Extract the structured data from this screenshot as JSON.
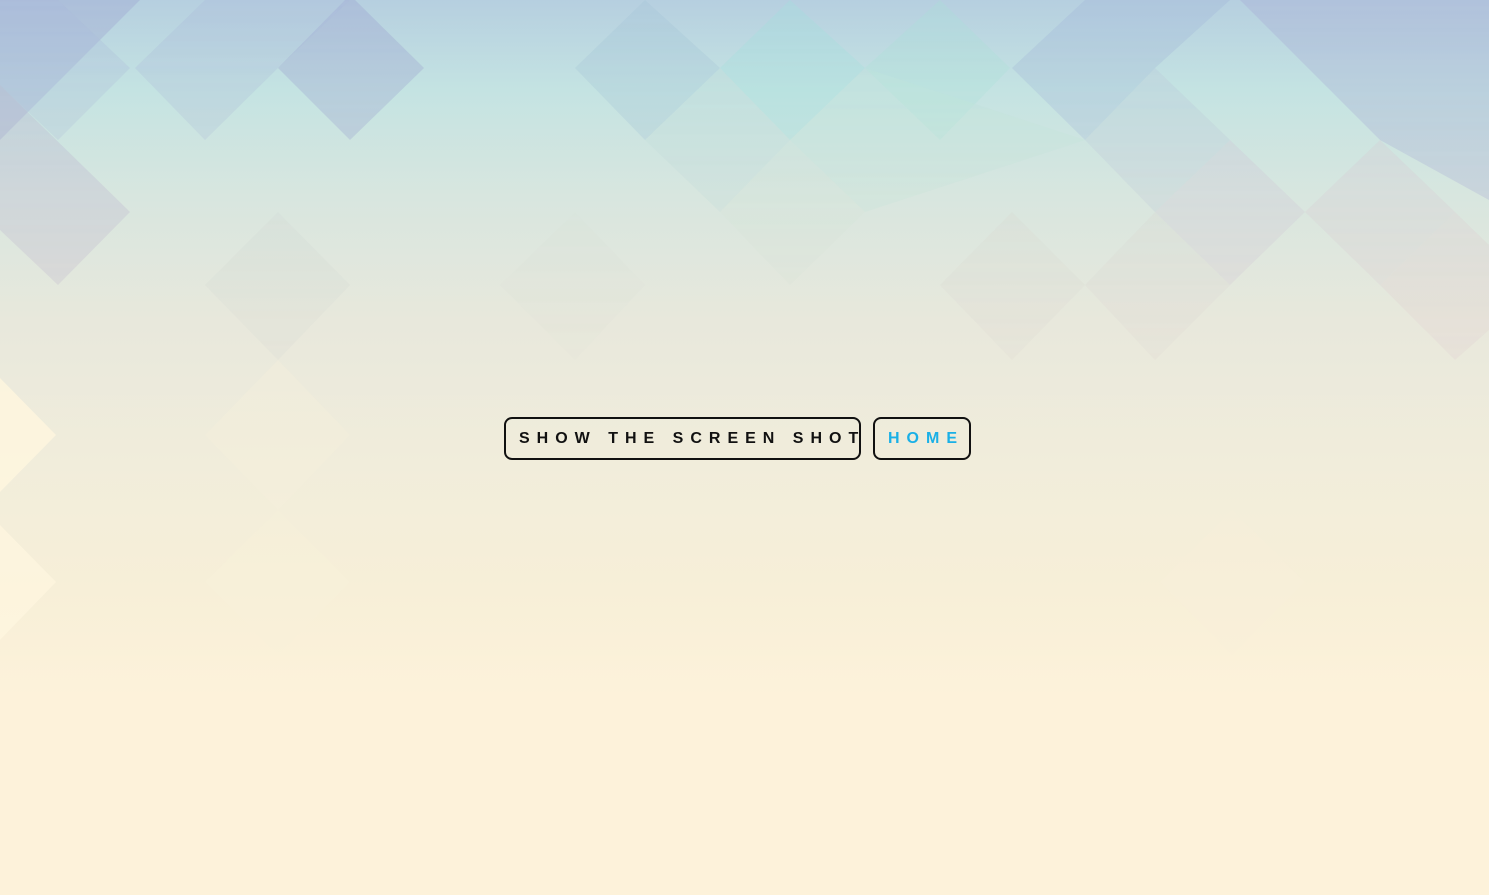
{
  "buttons": {
    "screenshot_label": "SHOW THE SCREEN SHOT",
    "home_label": "HOME"
  },
  "colors": {
    "home_text": "#1ab0e6",
    "screenshot_text": "#111111",
    "border": "#111111",
    "background_top": "#b6cfe0",
    "background_bottom": "#fdf2da"
  }
}
